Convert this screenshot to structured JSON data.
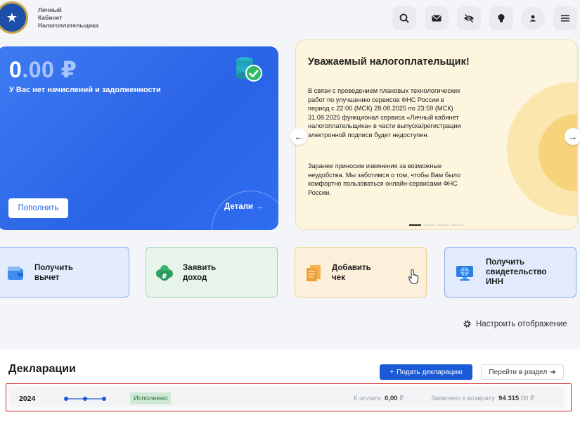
{
  "brand": {
    "line1": "Личный",
    "line2": "Кабинет",
    "line3": "Налогоплательщика"
  },
  "header_buttons": [
    "search-icon",
    "mail-icon",
    "eye-off-icon",
    "lightbulb-icon",
    "user-icon",
    "menu-icon"
  ],
  "balance": {
    "amount_int": "0",
    "amount_dec": ".00 ₽",
    "subtitle": "У Вас нет начислений и задолженности",
    "topup_label": "Пополнить",
    "details_label": "Детали →",
    "background": "#2a63e6"
  },
  "notice": {
    "title": "Уважаемый налогоплательщик!",
    "paragraph1": "В связи с проведением плановых технологических работ по улучшению сервисов ФНС России в период с 22:00 (МСК) 28.08.2025 по 23:59 (МСК) 31.08.2025 функционал сервиса «Личный кабинет налогоплательщика» в части выпуска/регистрации электронной подписи будет недоступен.",
    "paragraph2": "Заранее приносим извинения за возможные неудобства. Мы заботимся о том, чтобы Вам было комфортно пользоваться онлайн-сервисами ФНС России.",
    "prev": "←",
    "next": "→",
    "slides": 4,
    "active_slide": 1
  },
  "tiles": [
    {
      "line1": "Получить",
      "line2": "вычет"
    },
    {
      "line1": "Заявить",
      "line2": "доход"
    },
    {
      "line1": "Добавить",
      "line2": "чек"
    },
    {
      "line1": "Получить",
      "line2": "свидетельство",
      "line3": "ИНН"
    }
  ],
  "settings_label": "Настроить отображение",
  "declarations": {
    "title": "Декларации",
    "submit_label": "Подать декларацию",
    "goto_label": "Перейти в раздел",
    "row": {
      "year": "2024",
      "status": "Исполнено",
      "pay_label": "К оплате",
      "pay_value": "0,00",
      "return_label": "Заявлено к возврату",
      "return_value": "94 315",
      "return_dec": ",00",
      "currency": "₽"
    }
  }
}
